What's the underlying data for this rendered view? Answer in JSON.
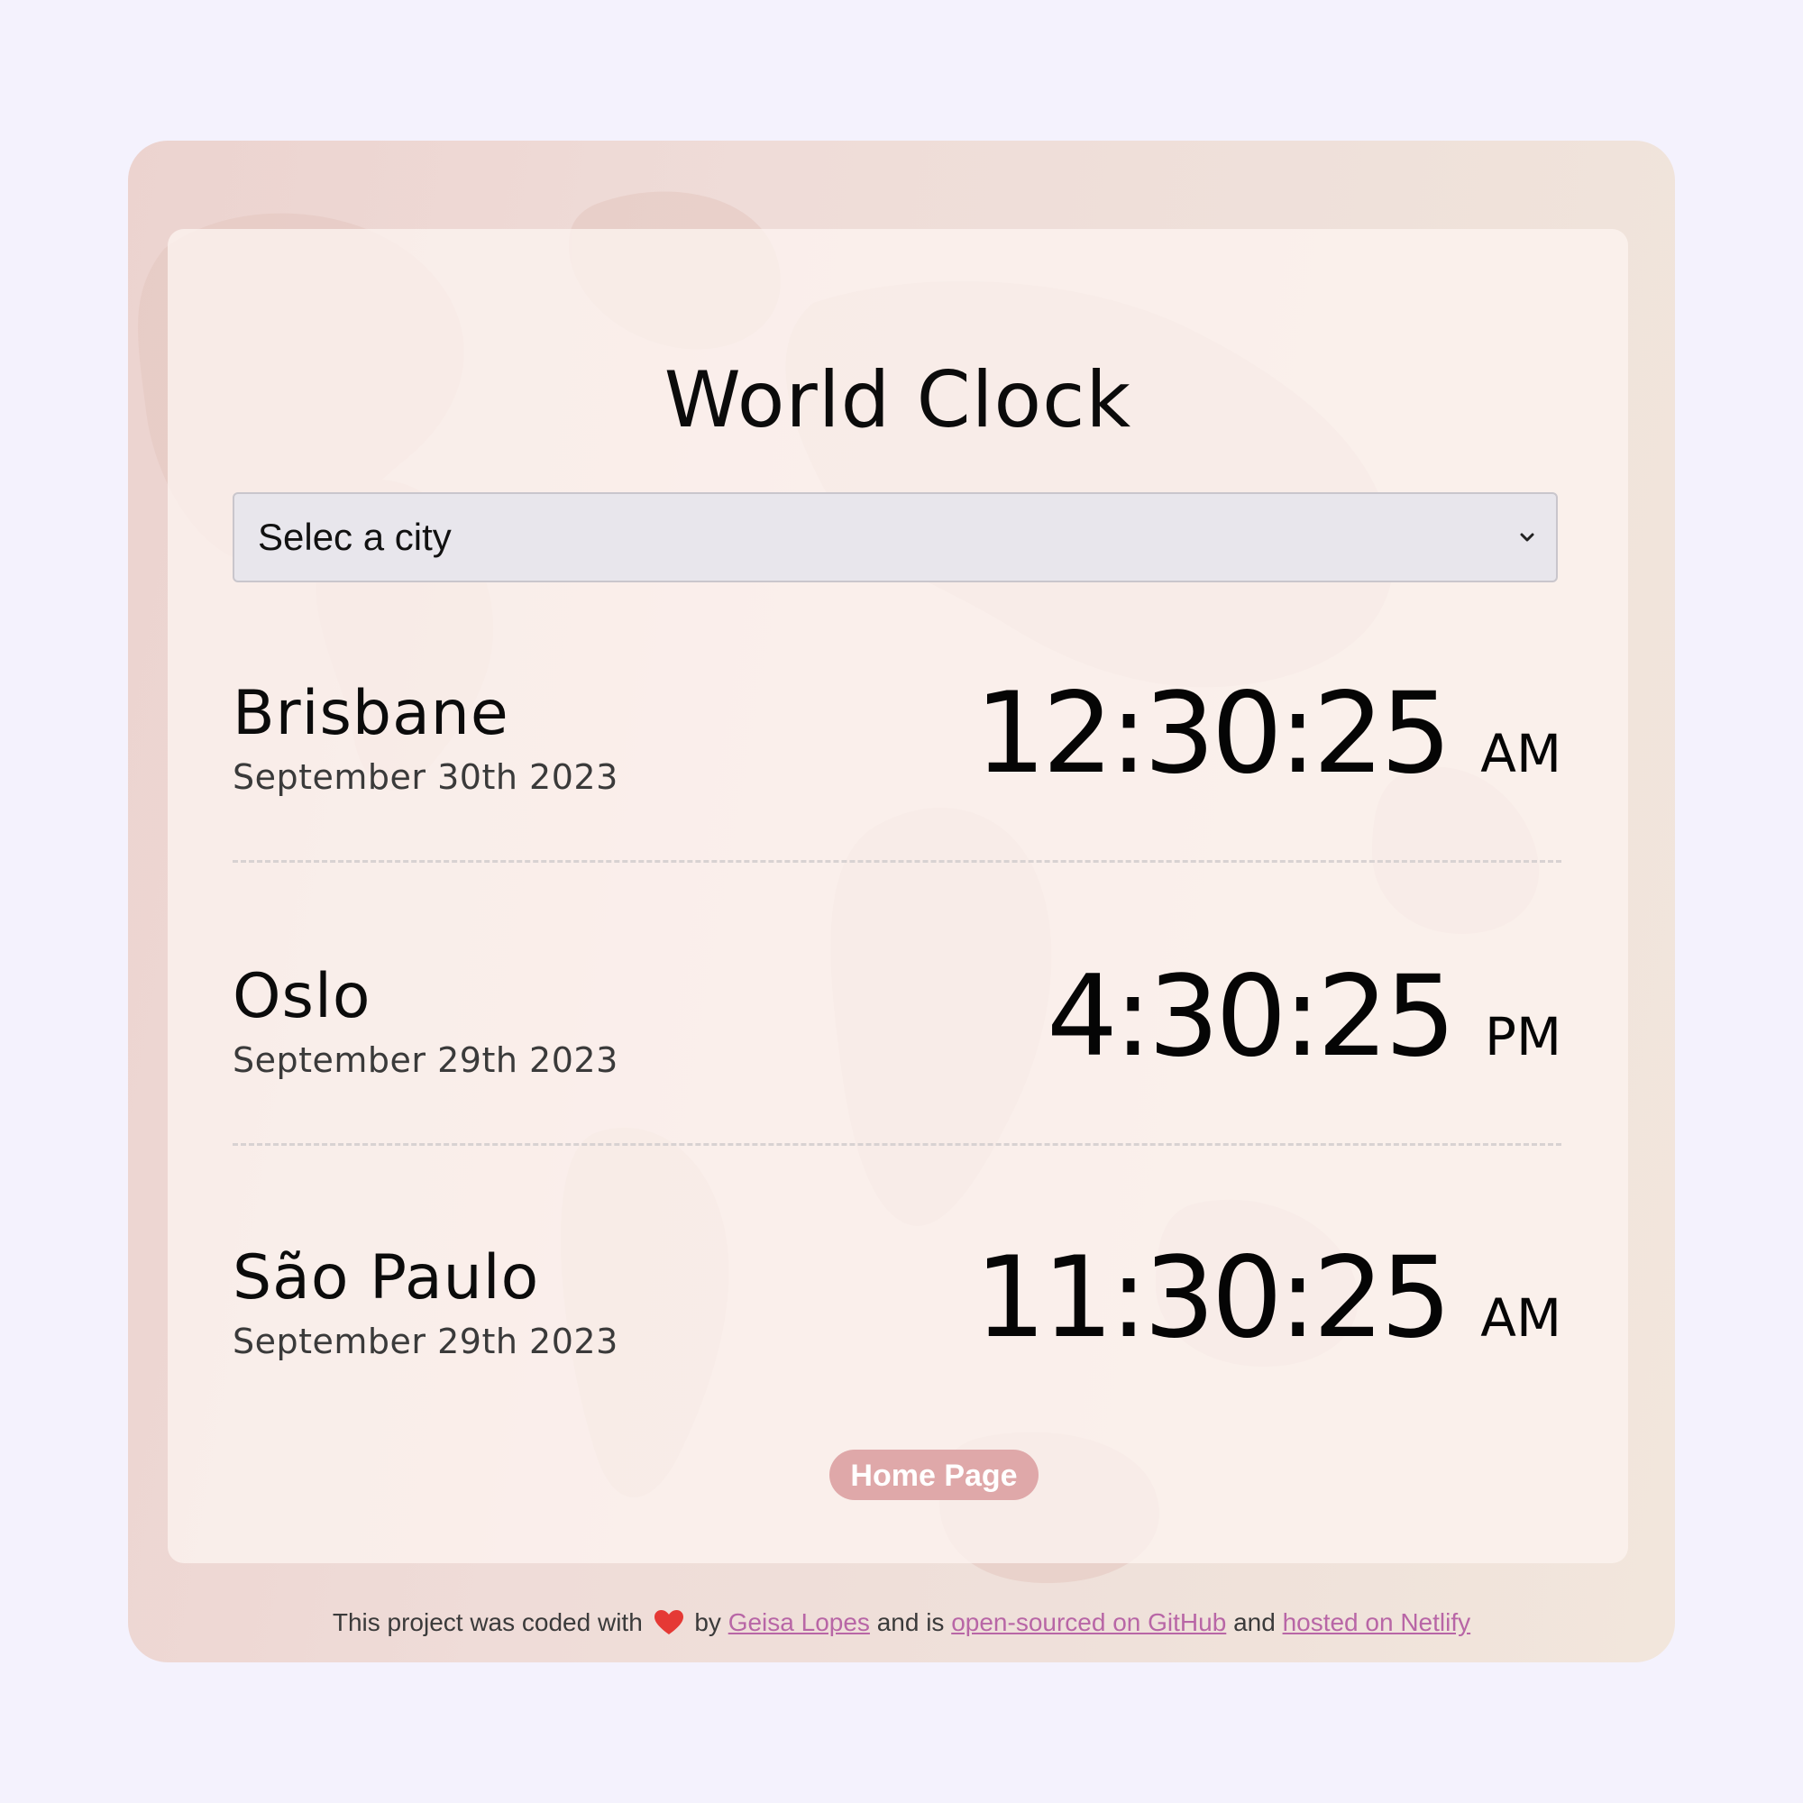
{
  "app": {
    "title": "World Clock"
  },
  "city_select": {
    "selected": "Selec a city"
  },
  "cities": [
    {
      "name": "Brisbane",
      "date": "September 30th 2023",
      "time": "12:30:25",
      "ampm": "AM"
    },
    {
      "name": "Oslo",
      "date": "September 29th 2023",
      "time": "4:30:25",
      "ampm": "PM"
    },
    {
      "name": "São Paulo",
      "date": "September 29th 2023",
      "time": "11:30:25",
      "ampm": "AM"
    }
  ],
  "home_button": {
    "label": "Home Page"
  },
  "footer": {
    "prefix": "This project was coded with",
    "by": "by",
    "author_link": "Geisa Lopes",
    "and_is": "and is",
    "github_link": "open-sourced on GitHub",
    "and": "and",
    "netlify_link": "hosted on Netlify"
  },
  "colors": {
    "page_bg": "#f4f2fd",
    "button_bg": "#dfa8a9",
    "link": "#b866a6",
    "heart": "#e53935"
  },
  "icons": {
    "dropdown": "chevron-down-icon",
    "love": "heart-icon"
  }
}
